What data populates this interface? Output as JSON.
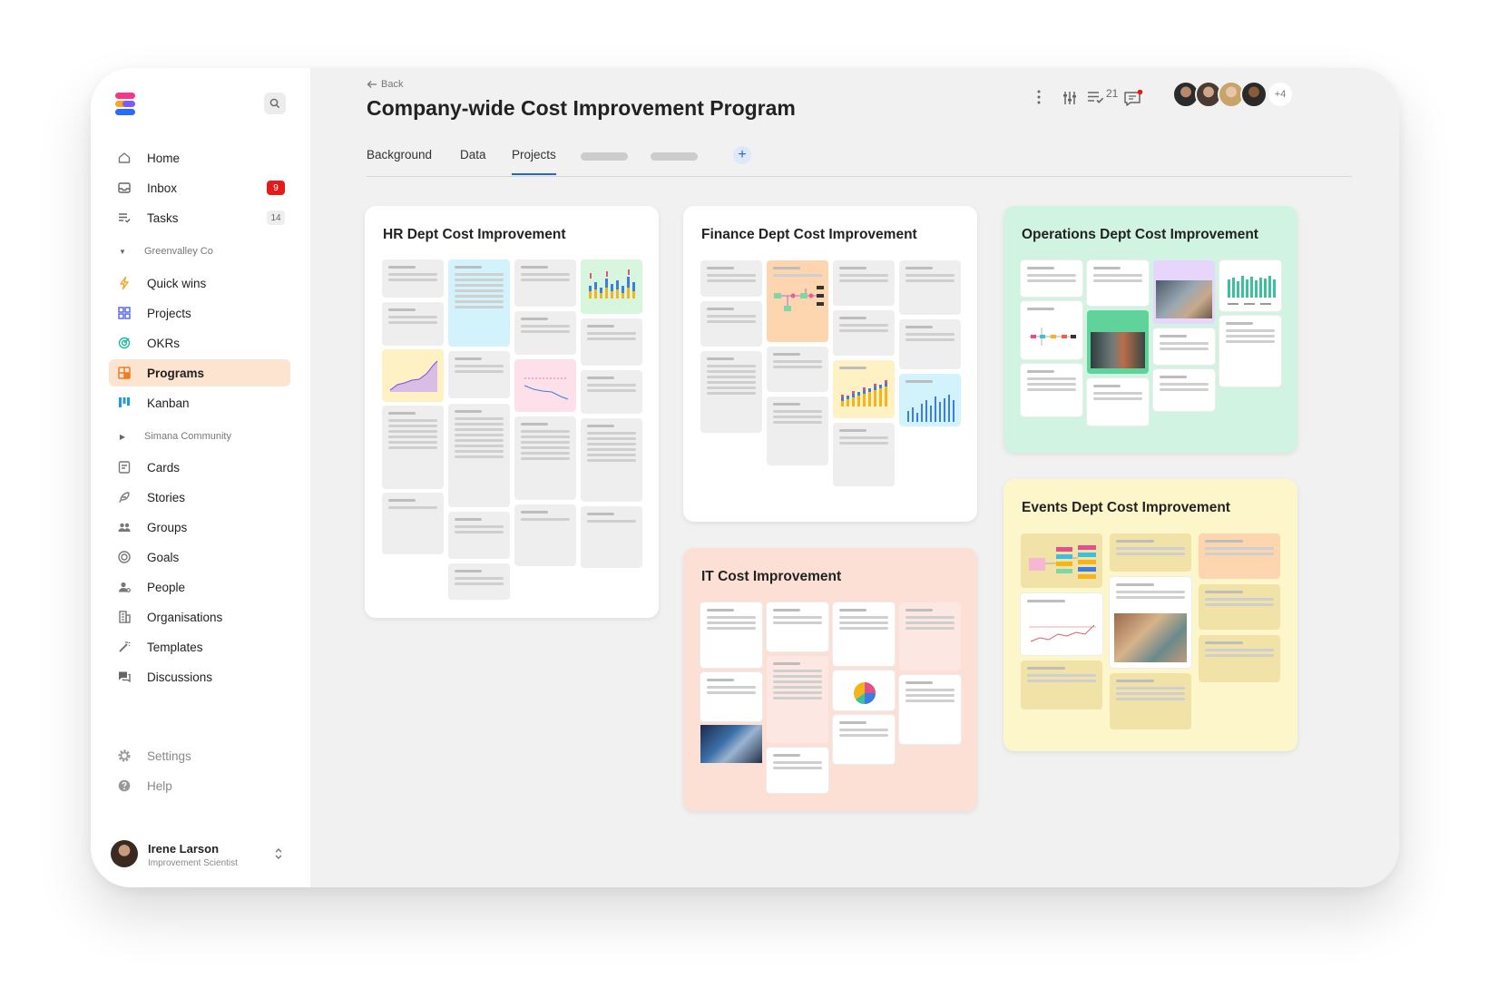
{
  "brand": {
    "logo_colors": [
      "#f5378c",
      "#f6a623",
      "#2b6cf6",
      "#7b5cf5"
    ]
  },
  "sidebar": {
    "items": [
      {
        "label": "Home",
        "icon": "home-icon"
      },
      {
        "label": "Inbox",
        "icon": "inbox-icon",
        "badge": "9"
      },
      {
        "label": "Tasks",
        "icon": "tasks-icon",
        "badge": "14"
      },
      {
        "label": "Quick wins",
        "icon": "lightning-icon"
      },
      {
        "label": "Projects",
        "icon": "grid-icon"
      },
      {
        "label": "OKRs",
        "icon": "target-icon"
      },
      {
        "label": "Programs",
        "icon": "programs-icon"
      },
      {
        "label": "Kanban",
        "icon": "kanban-icon"
      },
      {
        "label": "Cards",
        "icon": "cards-icon"
      },
      {
        "label": "Stories",
        "icon": "feather-icon"
      },
      {
        "label": "Groups",
        "icon": "groups-icon"
      },
      {
        "label": "Goals",
        "icon": "goals-icon"
      },
      {
        "label": "People",
        "icon": "people-icon"
      },
      {
        "label": "Organisations",
        "icon": "building-icon"
      },
      {
        "label": "Templates",
        "icon": "wand-icon"
      },
      {
        "label": "Discussions",
        "icon": "chat-icon"
      }
    ],
    "sections": [
      "Greenvalley Co",
      "Simana Community"
    ],
    "footer": [
      {
        "label": "Settings",
        "icon": "gear-icon"
      },
      {
        "label": "Help",
        "icon": "help-icon"
      }
    ],
    "user": {
      "name": "Irene Larson",
      "role": "Improvement Scientist"
    }
  },
  "header": {
    "back_label": "Back",
    "title": "Company-wide Cost Improvement Program",
    "tabs": [
      "Background",
      "Data",
      "Projects"
    ],
    "active_tab": "Projects",
    "discussion_count": "21",
    "avatars_extra": "+4"
  },
  "cards": {
    "hr": "HR Dept Cost Improvement",
    "finance": "Finance Dept Cost Improvement",
    "operations": "Operations Dept Cost Improvement",
    "it": "IT Cost Improvement",
    "events": "Events Dept Cost Improvement"
  },
  "colors": {
    "accent": "#1f66d1",
    "active_nav": "#fde4d0",
    "operations_bg": "#d1f4e2",
    "it_bg": "#fde0d5",
    "events_bg": "#fef6cb",
    "badge_red": "#e41b1b"
  }
}
